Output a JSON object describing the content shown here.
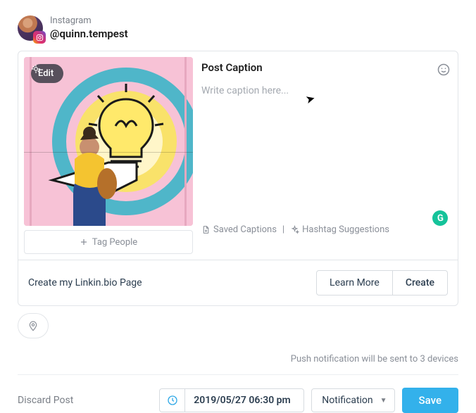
{
  "account": {
    "platform": "Instagram",
    "handle": "@quinn.tempest"
  },
  "composer": {
    "edit_label": "Edit",
    "tag_people_label": "Tag People",
    "caption_title": "Post Caption",
    "caption_placeholder": "Write caption here...",
    "caption_value": "",
    "saved_captions_label": "Saved Captions",
    "tool_separator": "|",
    "hashtag_suggestions_label": "Hashtag Suggestions"
  },
  "linkin": {
    "prompt": "Create my Linkin.bio Page",
    "learn_more": "Learn More",
    "create": "Create"
  },
  "push_notification_text": "Push notification will be sent to 3 devices",
  "footer": {
    "discard_label": "Discard Post",
    "datetime_value": "2019/05/27 06:30 pm",
    "notification_label": "Notification",
    "save_label": "Save"
  }
}
